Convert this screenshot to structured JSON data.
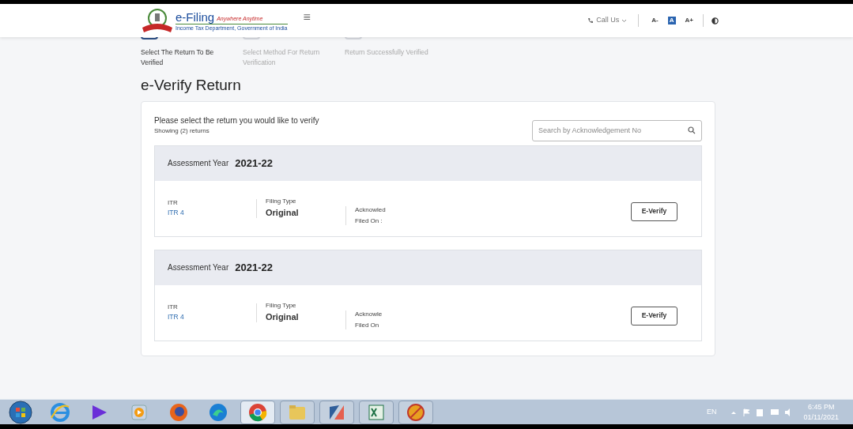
{
  "header": {
    "logo_title": "e-Filing",
    "logo_tagline": "Anywhere Anytime",
    "logo_subtitle": "Income Tax Department, Government of India",
    "menu_icon": "≡",
    "call_us": "Call Us",
    "font_controls": [
      "A-",
      "A",
      "A+"
    ]
  },
  "steps": [
    {
      "label": "Select The Return To Be Verified",
      "selected": true
    },
    {
      "label": "Select Method For Return Verification",
      "selected": false
    },
    {
      "label": "Return Successfully Verified",
      "selected": false
    }
  ],
  "page_title": "e-Verify Return",
  "panel": {
    "prompt": "Please select the return you would like to verify",
    "count": "Showing (2) returns",
    "search": {
      "placeholder": "Search by Acknowledgement No"
    },
    "returns": [
      {
        "ay_label": "Assessment Year",
        "ay": "2021-22",
        "itr_label": "ITR",
        "itr": "ITR 4",
        "filing_type_label": "Filing Type",
        "filing_type": "Original",
        "ack_label": "Acknowled",
        "filed_on_label": "Filed On :",
        "button": "E-Verify"
      },
      {
        "ay_label": "Assessment Year",
        "ay": "2021-22",
        "itr_label": "ITR",
        "itr": "ITR 4",
        "filing_type_label": "Filing Type",
        "filing_type": "Original",
        "ack_label": "Acknowle",
        "filed_on_label": "Filed On",
        "button": "E-Verify"
      }
    ]
  },
  "taskbar": {
    "language": "EN",
    "time": "6:45 PM",
    "date": "01/11/2021"
  }
}
